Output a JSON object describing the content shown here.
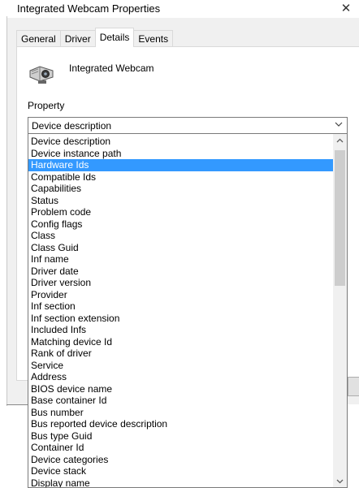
{
  "window": {
    "title": "Integrated Webcam Properties",
    "close_glyph": "✕"
  },
  "tabs": [
    {
      "label": "General",
      "active": false
    },
    {
      "label": "Driver",
      "active": false
    },
    {
      "label": "Details",
      "active": true
    },
    {
      "label": "Events",
      "active": false
    }
  ],
  "device": {
    "name": "Integrated Webcam",
    "icon": "webcam-icon"
  },
  "property": {
    "label": "Property",
    "selected_value": "Device description",
    "options": [
      "Device description",
      "Device instance path",
      "Hardware Ids",
      "Compatible Ids",
      "Capabilities",
      "Status",
      "Problem code",
      "Config flags",
      "Class",
      "Class Guid",
      "Inf name",
      "Driver date",
      "Driver version",
      "Provider",
      "Inf section",
      "Inf section extension",
      "Included Infs",
      "Matching device Id",
      "Rank of driver",
      "Service",
      "Address",
      "BIOS device name",
      "Base container Id",
      "Bus number",
      "Bus reported device description",
      "Bus type Guid",
      "Container Id",
      "Device categories",
      "Device stack",
      "Display name"
    ],
    "highlighted_option": "Hardware Ids"
  },
  "colors": {
    "highlight": "#3399ff",
    "dialog_bg": "#f0f0f0",
    "border": "#7a7a7a"
  }
}
